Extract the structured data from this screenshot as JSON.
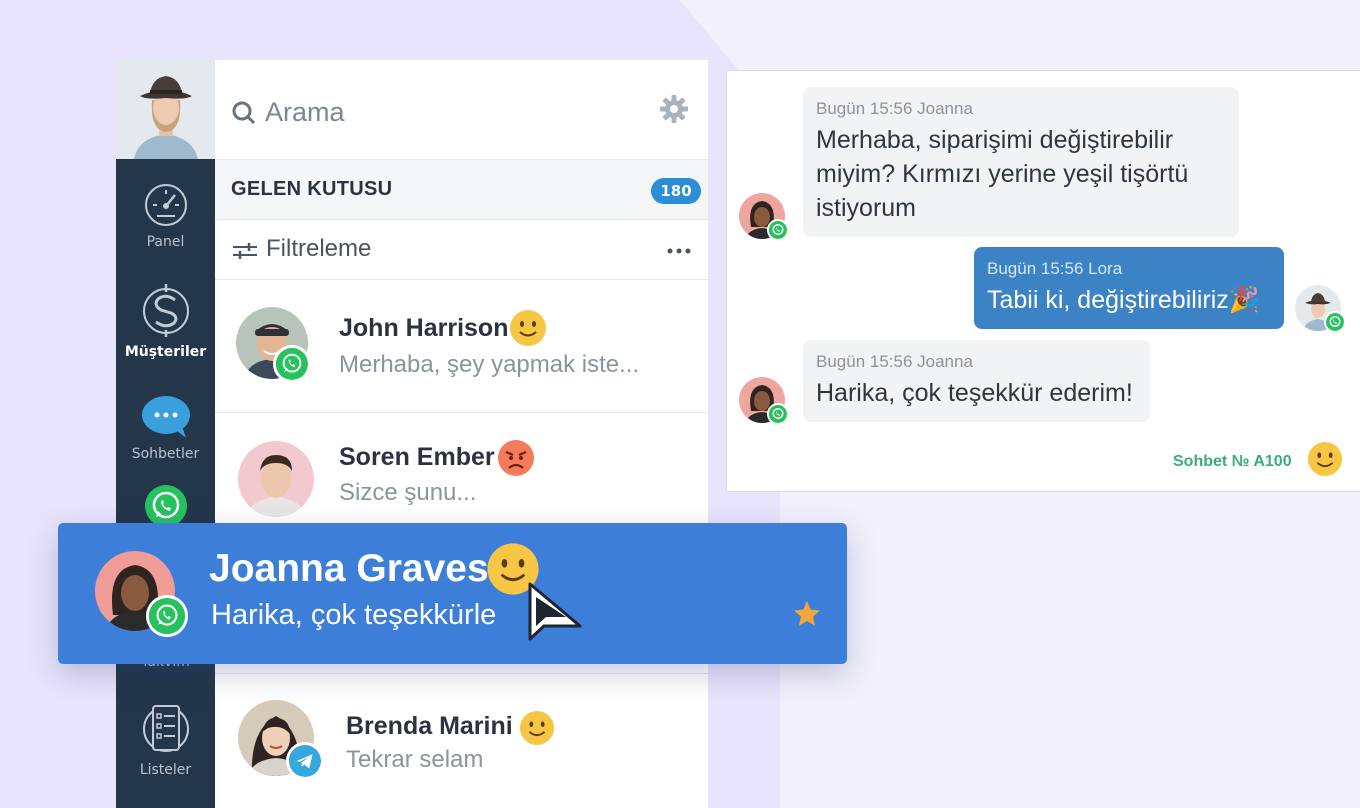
{
  "sidebar": {
    "items": [
      {
        "label": "Panel",
        "icon": "gauge-icon"
      },
      {
        "label": "Müşteriler",
        "icon": "dollar-icon",
        "active": true
      },
      {
        "label": "Sohbetler",
        "icon": "chat-bubble-icon"
      },
      {
        "label": "",
        "icon": "whatsapp-icon"
      },
      {
        "label": "Takvim",
        "icon": "calendar-icon"
      },
      {
        "label": "Listeler",
        "icon": "list-icon"
      }
    ]
  },
  "list": {
    "search_placeholder": "Arama",
    "inbox_title": "GELEN KUTUSU",
    "inbox_count": "180",
    "filter_label": "Filtreleme",
    "conversations": [
      {
        "name": "John Harrison",
        "preview": "Merhaba, şey yapmak iste...",
        "channel": "whatsapp",
        "emoji": "smile"
      },
      {
        "name": "Soren Ember",
        "preview": "Sizce şunu...",
        "channel": "instagram",
        "emoji": "angry"
      },
      {
        "name": "Joanna Graves",
        "preview": "Harika, çok teşekkürle",
        "channel": "whatsapp",
        "emoji": "smile",
        "starred": true
      },
      {
        "name": "Brenda Marini",
        "preview": "Tekrar selam",
        "channel": "telegram",
        "emoji": "smile"
      }
    ]
  },
  "chat": {
    "messages": [
      {
        "meta": "Bugün 15:56 Joanna",
        "text": "Merhaba, siparişimi değiştirebilir miyim? Kırmızı yerine yeşil tişörtü istiyorum",
        "direction": "in"
      },
      {
        "meta": "Bugün 15:56 Lora",
        "text": "Tabii ki, değiştirebiliriz🎉",
        "direction": "out"
      },
      {
        "meta": "Bugün 15:56 Joanna",
        "text": "Harika, çok teşekkür ederim!",
        "direction": "in"
      }
    ],
    "footer": "Sohbet № A100"
  },
  "colors": {
    "sidebar": "#23364a",
    "accent": "#3d7ed8",
    "badge": "#2a8fd6",
    "outgoing_bubble": "#3c83c6",
    "whatsapp": "#25c25e",
    "star": "#f2a93b"
  }
}
